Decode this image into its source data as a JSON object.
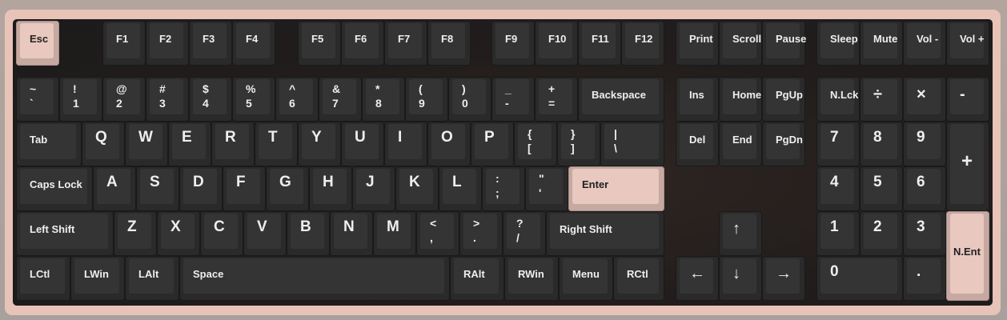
{
  "colors": {
    "accent_key": "#e8c8bf",
    "dark_key": "#353434",
    "case": "#e7c3b8",
    "plate": "#221d1c",
    "legend_dark": "#eeeeee",
    "legend_light": "#222222"
  },
  "keys": {
    "esc": "Esc",
    "f1": "F1",
    "f2": "F2",
    "f3": "F3",
    "f4": "F4",
    "f5": "F5",
    "f6": "F6",
    "f7": "F7",
    "f8": "F8",
    "f9": "F9",
    "f10": "F10",
    "f11": "F11",
    "f12": "F12",
    "print": "Print",
    "scroll": "Scroll",
    "pause": "Pause",
    "sleep": "Sleep",
    "mute": "Mute",
    "vol_down": "Vol -",
    "vol_up": "Vol +",
    "tilde": {
      "shift": "~",
      "base": "`"
    },
    "n1": {
      "shift": "!",
      "base": "1"
    },
    "n2": {
      "shift": "@",
      "base": "2"
    },
    "n3": {
      "shift": "#",
      "base": "3"
    },
    "n4": {
      "shift": "$",
      "base": "4"
    },
    "n5": {
      "shift": "%",
      "base": "5"
    },
    "n6": {
      "shift": "^",
      "base": "6"
    },
    "n7": {
      "shift": "&",
      "base": "7"
    },
    "n8": {
      "shift": "*",
      "base": "8"
    },
    "n9": {
      "shift": "(",
      "base": "9"
    },
    "n0": {
      "shift": ")",
      "base": "0"
    },
    "minus": {
      "shift": "_",
      "base": "-"
    },
    "equal": {
      "shift": "+",
      "base": "="
    },
    "backspace": "Backspace",
    "ins": "Ins",
    "home": "Home",
    "pgup": "PgUp",
    "numlock": "N.Lck",
    "np_div": "÷",
    "np_mul": "×",
    "np_minus": "-",
    "tab": "Tab",
    "q": "Q",
    "w": "W",
    "e": "E",
    "r": "R",
    "t": "T",
    "y": "Y",
    "u": "U",
    "i": "I",
    "o": "O",
    "p": "P",
    "lbracket": {
      "shift": "{",
      "base": "["
    },
    "rbracket": {
      "shift": "}",
      "base": "]"
    },
    "backslash": {
      "shift": "|",
      "base": "\\"
    },
    "del": "Del",
    "end": "End",
    "pgdn": "PgDn",
    "np7": "7",
    "np8": "8",
    "np9": "9",
    "np_plus": "+",
    "caps": "Caps Lock",
    "a": "A",
    "s": "S",
    "d": "D",
    "f": "F",
    "g": "G",
    "h": "H",
    "j": "J",
    "k": "K",
    "l": "L",
    "semicolon": {
      "shift": ":",
      "base": ";"
    },
    "quote": {
      "shift": "\"",
      "base": "'"
    },
    "enter": "Enter",
    "np4": "4",
    "np5": "5",
    "np6": "6",
    "lshift": "Left Shift",
    "z": "Z",
    "x": "X",
    "c": "C",
    "v": "V",
    "b": "B",
    "n": "N",
    "m": "M",
    "comma": {
      "shift": "<",
      "base": ","
    },
    "period": {
      "shift": ">",
      "base": "."
    },
    "slash": {
      "shift": "?",
      "base": "/"
    },
    "rshift": "Right Shift",
    "up": "↑",
    "np1": "1",
    "np2": "2",
    "np3": "3",
    "np_enter": "N.Ent",
    "lctl": "LCtl",
    "lwin": "LWin",
    "lalt": "LAlt",
    "space": "Space",
    "ralt": "RAlt",
    "rwin": "RWin",
    "menu": "Menu",
    "rctl": "RCtl",
    "left": "←",
    "down": "↓",
    "right": "→",
    "np0": "0",
    "np_dot": "."
  }
}
